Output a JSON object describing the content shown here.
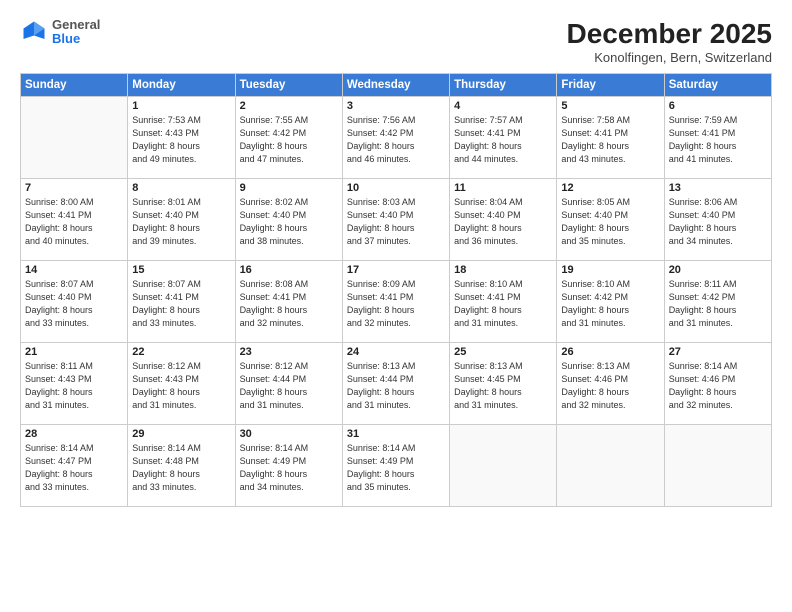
{
  "header": {
    "logo_general": "General",
    "logo_blue": "Blue",
    "month_title": "December 2025",
    "location": "Konolfingen, Bern, Switzerland"
  },
  "weekdays": [
    "Sunday",
    "Monday",
    "Tuesday",
    "Wednesday",
    "Thursday",
    "Friday",
    "Saturday"
  ],
  "weeks": [
    [
      {
        "day": "",
        "info": ""
      },
      {
        "day": "1",
        "info": "Sunrise: 7:53 AM\nSunset: 4:43 PM\nDaylight: 8 hours\nand 49 minutes."
      },
      {
        "day": "2",
        "info": "Sunrise: 7:55 AM\nSunset: 4:42 PM\nDaylight: 8 hours\nand 47 minutes."
      },
      {
        "day": "3",
        "info": "Sunrise: 7:56 AM\nSunset: 4:42 PM\nDaylight: 8 hours\nand 46 minutes."
      },
      {
        "day": "4",
        "info": "Sunrise: 7:57 AM\nSunset: 4:41 PM\nDaylight: 8 hours\nand 44 minutes."
      },
      {
        "day": "5",
        "info": "Sunrise: 7:58 AM\nSunset: 4:41 PM\nDaylight: 8 hours\nand 43 minutes."
      },
      {
        "day": "6",
        "info": "Sunrise: 7:59 AM\nSunset: 4:41 PM\nDaylight: 8 hours\nand 41 minutes."
      }
    ],
    [
      {
        "day": "7",
        "info": "Sunrise: 8:00 AM\nSunset: 4:41 PM\nDaylight: 8 hours\nand 40 minutes."
      },
      {
        "day": "8",
        "info": "Sunrise: 8:01 AM\nSunset: 4:40 PM\nDaylight: 8 hours\nand 39 minutes."
      },
      {
        "day": "9",
        "info": "Sunrise: 8:02 AM\nSunset: 4:40 PM\nDaylight: 8 hours\nand 38 minutes."
      },
      {
        "day": "10",
        "info": "Sunrise: 8:03 AM\nSunset: 4:40 PM\nDaylight: 8 hours\nand 37 minutes."
      },
      {
        "day": "11",
        "info": "Sunrise: 8:04 AM\nSunset: 4:40 PM\nDaylight: 8 hours\nand 36 minutes."
      },
      {
        "day": "12",
        "info": "Sunrise: 8:05 AM\nSunset: 4:40 PM\nDaylight: 8 hours\nand 35 minutes."
      },
      {
        "day": "13",
        "info": "Sunrise: 8:06 AM\nSunset: 4:40 PM\nDaylight: 8 hours\nand 34 minutes."
      }
    ],
    [
      {
        "day": "14",
        "info": "Sunrise: 8:07 AM\nSunset: 4:40 PM\nDaylight: 8 hours\nand 33 minutes."
      },
      {
        "day": "15",
        "info": "Sunrise: 8:07 AM\nSunset: 4:41 PM\nDaylight: 8 hours\nand 33 minutes."
      },
      {
        "day": "16",
        "info": "Sunrise: 8:08 AM\nSunset: 4:41 PM\nDaylight: 8 hours\nand 32 minutes."
      },
      {
        "day": "17",
        "info": "Sunrise: 8:09 AM\nSunset: 4:41 PM\nDaylight: 8 hours\nand 32 minutes."
      },
      {
        "day": "18",
        "info": "Sunrise: 8:10 AM\nSunset: 4:41 PM\nDaylight: 8 hours\nand 31 minutes."
      },
      {
        "day": "19",
        "info": "Sunrise: 8:10 AM\nSunset: 4:42 PM\nDaylight: 8 hours\nand 31 minutes."
      },
      {
        "day": "20",
        "info": "Sunrise: 8:11 AM\nSunset: 4:42 PM\nDaylight: 8 hours\nand 31 minutes."
      }
    ],
    [
      {
        "day": "21",
        "info": "Sunrise: 8:11 AM\nSunset: 4:43 PM\nDaylight: 8 hours\nand 31 minutes."
      },
      {
        "day": "22",
        "info": "Sunrise: 8:12 AM\nSunset: 4:43 PM\nDaylight: 8 hours\nand 31 minutes."
      },
      {
        "day": "23",
        "info": "Sunrise: 8:12 AM\nSunset: 4:44 PM\nDaylight: 8 hours\nand 31 minutes."
      },
      {
        "day": "24",
        "info": "Sunrise: 8:13 AM\nSunset: 4:44 PM\nDaylight: 8 hours\nand 31 minutes."
      },
      {
        "day": "25",
        "info": "Sunrise: 8:13 AM\nSunset: 4:45 PM\nDaylight: 8 hours\nand 31 minutes."
      },
      {
        "day": "26",
        "info": "Sunrise: 8:13 AM\nSunset: 4:46 PM\nDaylight: 8 hours\nand 32 minutes."
      },
      {
        "day": "27",
        "info": "Sunrise: 8:14 AM\nSunset: 4:46 PM\nDaylight: 8 hours\nand 32 minutes."
      }
    ],
    [
      {
        "day": "28",
        "info": "Sunrise: 8:14 AM\nSunset: 4:47 PM\nDaylight: 8 hours\nand 33 minutes."
      },
      {
        "day": "29",
        "info": "Sunrise: 8:14 AM\nSunset: 4:48 PM\nDaylight: 8 hours\nand 33 minutes."
      },
      {
        "day": "30",
        "info": "Sunrise: 8:14 AM\nSunset: 4:49 PM\nDaylight: 8 hours\nand 34 minutes."
      },
      {
        "day": "31",
        "info": "Sunrise: 8:14 AM\nSunset: 4:49 PM\nDaylight: 8 hours\nand 35 minutes."
      },
      {
        "day": "",
        "info": ""
      },
      {
        "day": "",
        "info": ""
      },
      {
        "day": "",
        "info": ""
      }
    ]
  ]
}
